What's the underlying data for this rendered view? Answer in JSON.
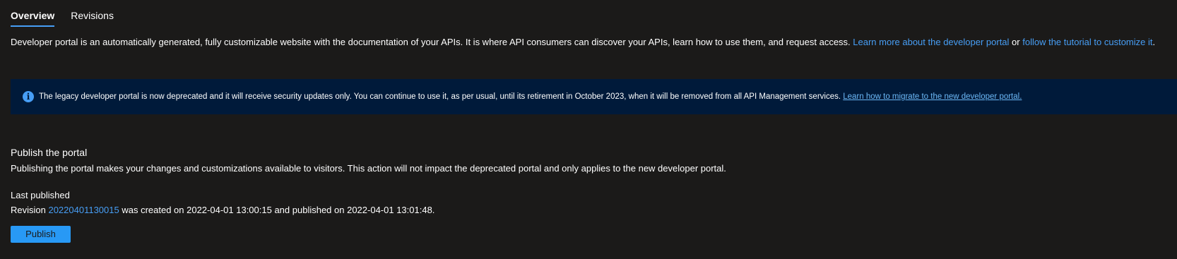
{
  "tabs": [
    {
      "label": "Overview",
      "active": true
    },
    {
      "label": "Revisions",
      "active": false
    }
  ],
  "description": {
    "text": "Developer portal is an automatically generated, fully customizable website with the documentation of your APIs. It is where API consumers can discover your APIs, learn how to use them, and request access. ",
    "link1": "Learn more about the developer portal",
    "connector": " or ",
    "link2": "follow the tutorial to customize it",
    "end": "."
  },
  "banner": {
    "icon": "info-icon",
    "text": "The legacy developer portal is now deprecated and it will receive security updates only. You can continue to use it, as per usual, until its retirement in October 2023, when it will be removed from all API Management services. ",
    "link": "Learn how to migrate to the new developer portal.",
    "background": "#001a3a"
  },
  "publish_section": {
    "title": "Publish the portal",
    "description": "Publishing the portal makes your changes and customizations available to visitors. This action will not impact the deprecated portal and only applies to the new developer portal.",
    "last_published_label": "Last published",
    "revision_prefix": "Revision ",
    "revision_id": "20220401130015",
    "revision_suffix": " was created on 2022-04-01 13:00:15 and published on 2022-04-01 13:01:48.",
    "publish_button_label": "Publish"
  },
  "colors": {
    "background": "#1b1a19",
    "accent": "#479ef5",
    "button": "#2899f5"
  }
}
